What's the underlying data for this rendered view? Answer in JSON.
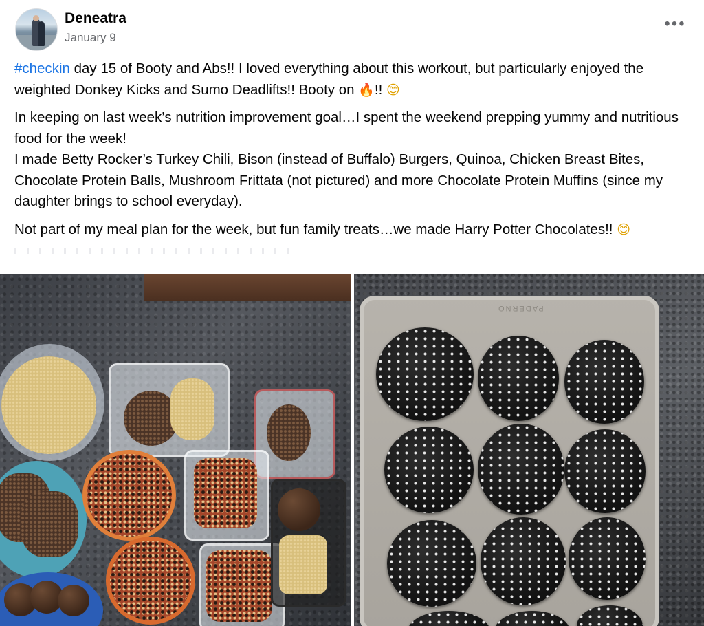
{
  "post": {
    "author_name": "Deneatra",
    "date": "January 9",
    "more_label": "•••",
    "paragraph1": {
      "hashtag": "#checkin",
      "text": " day 15 of Booty and Abs!! I loved everything about this workout, but particularly enjoyed the weighted Donkey Kicks and Sumo Deadlifts!! Booty on ",
      "emoji_fire": "🔥",
      "text_after": "!! ",
      "emoji_smile": "😊"
    },
    "paragraph2_line1": "In keeping on last week’s nutrition improvement goal…I spent the weekend prepping yummy and nutritious food for the week!",
    "paragraph2_line2": "I made Betty Rocker’s Turkey Chili, Bison (instead of Buffalo) Burgers, Quinoa, Chicken Breast Bites, Chocolate Protein Balls, Mushroom Frittata (not pictured) and more Chocolate Protein Muffins (since my daughter brings to school everyday).",
    "paragraph3": {
      "text": "Not part of my meal plan for the week, but fun family treats…we made Harry Potter Chocolates!! ",
      "emoji_smile": "😊"
    },
    "photos": [
      {
        "icon": "meal-prep-photo"
      },
      {
        "icon": "muffin-tray-photo",
        "brand_text": "PADERNO"
      }
    ]
  }
}
